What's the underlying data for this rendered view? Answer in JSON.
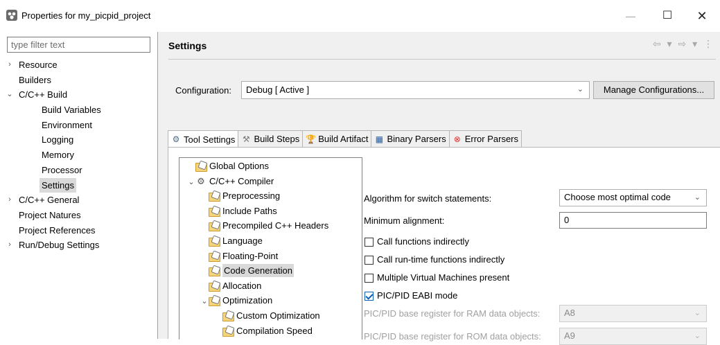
{
  "window": {
    "title": "Properties for my_picpid_project",
    "minimize": "—",
    "maximize": "☐",
    "close": "✕"
  },
  "filter": {
    "placeholder": "type filter text"
  },
  "left_tree": [
    {
      "label": "Resource",
      "arrow": "›",
      "indent": 0
    },
    {
      "label": "Builders",
      "arrow": "",
      "indent": 0
    },
    {
      "label": "C/C++ Build",
      "arrow": "⌄",
      "indent": 0
    },
    {
      "label": "Build Variables",
      "arrow": "",
      "indent": 1
    },
    {
      "label": "Environment",
      "arrow": "",
      "indent": 1
    },
    {
      "label": "Logging",
      "arrow": "",
      "indent": 1
    },
    {
      "label": "Memory",
      "arrow": "",
      "indent": 1
    },
    {
      "label": "Processor",
      "arrow": "",
      "indent": 1
    },
    {
      "label": "Settings",
      "arrow": "",
      "indent": 1,
      "selected": true
    },
    {
      "label": "C/C++ General",
      "arrow": "›",
      "indent": 0
    },
    {
      "label": "Project Natures",
      "arrow": "",
      "indent": 0
    },
    {
      "label": "Project References",
      "arrow": "",
      "indent": 0
    },
    {
      "label": "Run/Debug Settings",
      "arrow": "›",
      "indent": 0
    }
  ],
  "header": {
    "title": "Settings",
    "back_icon": "⇦",
    "dropdown_icon": "▾",
    "forward_icon": "⇨",
    "menu_icon": "⋮"
  },
  "configuration": {
    "label": "Configuration:",
    "value": "Debug  [ Active ]",
    "manage_label": "Manage Configurations..."
  },
  "tabs": [
    {
      "label": "Tool Settings",
      "icon": "⚙",
      "active": true
    },
    {
      "label": "Build Steps",
      "icon": "⚒",
      "active": false
    },
    {
      "label": "Build Artifact",
      "icon": "🏆",
      "active": false
    },
    {
      "label": "Binary Parsers",
      "icon": "▦",
      "active": false
    },
    {
      "label": "Error Parsers",
      "icon": "⊗",
      "active": false
    }
  ],
  "tool_tree": [
    {
      "label": "Global Options",
      "level": 0,
      "arrow": "",
      "icon": "folder"
    },
    {
      "label": "C/C++ Compiler",
      "level": 0,
      "arrow": "⌄",
      "icon": "gear"
    },
    {
      "label": "Preprocessing",
      "level": 1,
      "arrow": "",
      "icon": "folder"
    },
    {
      "label": "Include Paths",
      "level": 1,
      "arrow": "",
      "icon": "folder"
    },
    {
      "label": "Precompiled C++ Headers",
      "level": 1,
      "arrow": "",
      "icon": "folder"
    },
    {
      "label": "Language",
      "level": 1,
      "arrow": "",
      "icon": "folder"
    },
    {
      "label": "Floating-Point",
      "level": 1,
      "arrow": "",
      "icon": "folder"
    },
    {
      "label": "Code Generation",
      "level": 1,
      "arrow": "",
      "icon": "folder",
      "selected": true
    },
    {
      "label": "Allocation",
      "level": 1,
      "arrow": "",
      "icon": "folder"
    },
    {
      "label": "Optimization",
      "level": 1,
      "arrow": "⌄",
      "icon": "folder"
    },
    {
      "label": "Custom Optimization",
      "level": 2,
      "arrow": "",
      "icon": "folder"
    },
    {
      "label": "Compilation Speed",
      "level": 2,
      "arrow": "",
      "icon": "folder"
    }
  ],
  "form": {
    "switch_label": "Algorithm for switch statements:",
    "switch_value": "Choose most optimal code",
    "alignment_label": "Minimum alignment:",
    "alignment_value": "0",
    "checkboxes": [
      {
        "label": "Call functions indirectly",
        "checked": false
      },
      {
        "label": "Call run-time functions indirectly",
        "checked": false
      },
      {
        "label": "Multiple Virtual Machines present",
        "checked": false
      },
      {
        "label": "PIC/PID EABI mode",
        "checked": true
      }
    ],
    "ram_label": "PIC/PID base register for RAM data objects:",
    "ram_value": "A8",
    "rom_label": "PIC/PID base register for ROM data objects:",
    "rom_value": "A9"
  },
  "colors": {
    "selection": "#d9d9d9",
    "panel_bg": "#f0f0f0",
    "check_blue": "#0a5fb4"
  }
}
